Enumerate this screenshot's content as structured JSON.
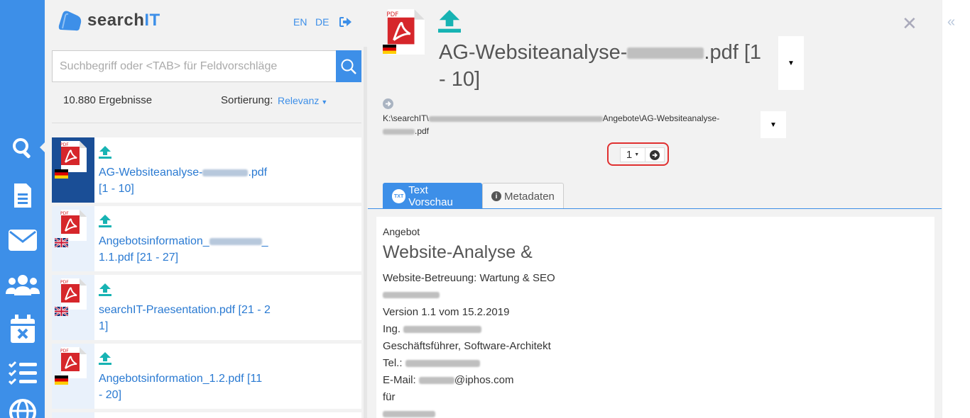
{
  "app": {
    "name_prefix": "search",
    "name_suffix": "IT"
  },
  "header": {
    "lang_en": "EN",
    "lang_de": "DE"
  },
  "search": {
    "placeholder": "Suchbegriff oder <TAB> für Feldvorschläge",
    "value": ""
  },
  "results": {
    "count_text": "10.880 Ergebnisse",
    "sort_label": "Sortierung:",
    "sort_value": "Relevanz",
    "items": [
      {
        "title_pre": "AG-Websiteanalyse-",
        "title_post": ".pdf",
        "range": "[1 - 10]",
        "flag": "de-flag"
      },
      {
        "title_pre": "Angebotsinformation_",
        "title_post": "_",
        "range": "1.1.pdf [21 - 27]",
        "flag": "uk-flag"
      },
      {
        "title_pre": "searchIT-Praesentation.pdf [21 - 2",
        "title_post": "",
        "range": "1]",
        "flag": "uk-flag"
      },
      {
        "title_pre": "Angebotsinformation_1.2.pdf [11",
        "title_post": "",
        "range": "- 20]",
        "flag": "de-flag"
      }
    ]
  },
  "preview": {
    "title_pre": "AG-Websiteanalyse-",
    "title_post": ".pdf [1",
    "title_line2": "- 10]",
    "path_pre": "K:\\searchIT\\",
    "path_mid": "Angebote\\AG-Websiteanalyse-",
    "path_end": ".pdf",
    "page_select": "1",
    "tabs": {
      "text_icon": "TXT",
      "text": "Text Vorschau",
      "meta": "Metadaten"
    }
  },
  "document": {
    "line1": "Angebot",
    "heading": "Website-Analyse &",
    "line3": "Website-Betreuung: Wartung & SEO",
    "version": "Version 1.1 vom 15.2.2019",
    "ing": "Ing.",
    "role": "Geschäftsführer, Software-Architekt",
    "tel": "Tel.:",
    "email_label": "E-Mail:",
    "email_domain": "@iphos.com",
    "fuer": "für"
  },
  "colors": {
    "accent": "#3d8fe8",
    "active_thumb": "#1a4e96",
    "pdf_red": "#d6262b",
    "upload_teal": "#17b3b3",
    "pager_border": "#e03030"
  },
  "icons": [
    "search-icon",
    "document-icon",
    "mail-icon",
    "users-icon",
    "calendar-x-icon",
    "checklist-icon",
    "globe-icon",
    "logout-icon",
    "upload-icon",
    "pdf-icon",
    "close-icon",
    "chevron-double-left-icon"
  ]
}
